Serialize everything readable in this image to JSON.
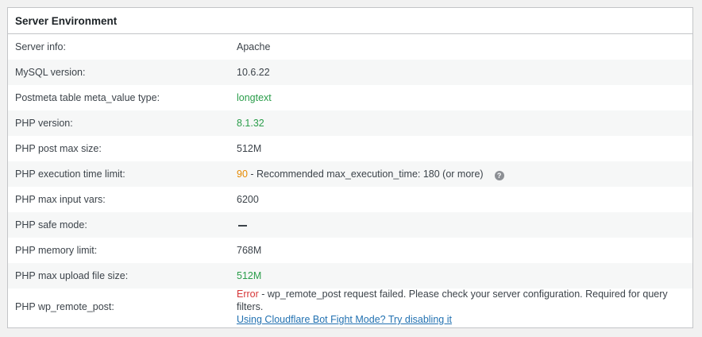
{
  "panel": {
    "title": "Server Environment"
  },
  "rows": [
    {
      "label": "Server info:",
      "value": "Apache"
    },
    {
      "label": "MySQL version:",
      "value": "10.6.22"
    },
    {
      "label": "Postmeta table meta_value type:",
      "value": "longtext"
    },
    {
      "label": "PHP version:",
      "value": "8.1.32"
    },
    {
      "label": "PHP post max size:",
      "value": "512M"
    },
    {
      "label": "PHP execution time limit:",
      "value": "90",
      "note": " - Recommended max_execution_time: 180 (or more)",
      "icon": "help-icon"
    },
    {
      "label": "PHP max input vars:",
      "value": "6200"
    },
    {
      "label": "PHP safe mode:",
      "icon": "dash-icon"
    },
    {
      "label": "PHP memory limit:",
      "value": "768M"
    },
    {
      "label": "PHP max upload file size:",
      "value": "512M"
    },
    {
      "label": "PHP wp_remote_post:",
      "value": "Error",
      "note": " - wp_remote_post request failed. Please check your server configuration. Required for query filters.",
      "link": "Using Cloudflare Bot Fight Mode? Try disabling it"
    }
  ],
  "colors": {
    "ok": "#2a9d4a",
    "warn": "#e68a00",
    "error": "#d63638",
    "link": "#2271b1"
  }
}
